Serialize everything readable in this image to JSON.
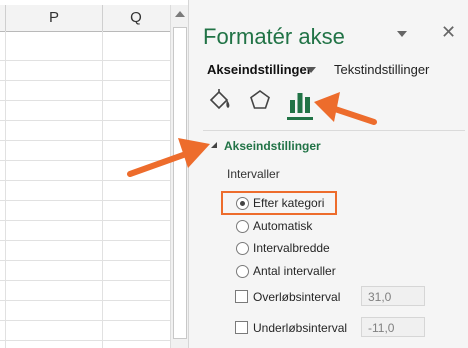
{
  "sheet": {
    "columns": [
      "P",
      "Q"
    ]
  },
  "pane": {
    "title": "Formatér akse",
    "tabs": [
      "Akseindstillinger",
      "Tekstindstillinger"
    ],
    "icons": [
      "fill-line-icon",
      "effects-pentagon-icon",
      "axis-options-bars-icon"
    ],
    "section_label": "Akseindstillinger",
    "group_label": "Intervaller",
    "options": [
      {
        "label": "Efter kategori",
        "type": "radio",
        "selected": true
      },
      {
        "label": "Automatisk",
        "type": "radio",
        "selected": false
      },
      {
        "label": "Intervalbredde",
        "type": "radio",
        "selected": false
      },
      {
        "label": "Antal intervaller",
        "type": "radio",
        "selected": false
      },
      {
        "label": "Overløbsinterval",
        "type": "checkbox",
        "checked": false,
        "value": "31,0"
      },
      {
        "label": "Underløbsinterval",
        "type": "checkbox",
        "checked": false,
        "value": "-11,0"
      }
    ]
  },
  "colors": {
    "accent": "#217346",
    "callout": "#ed6c2c"
  }
}
